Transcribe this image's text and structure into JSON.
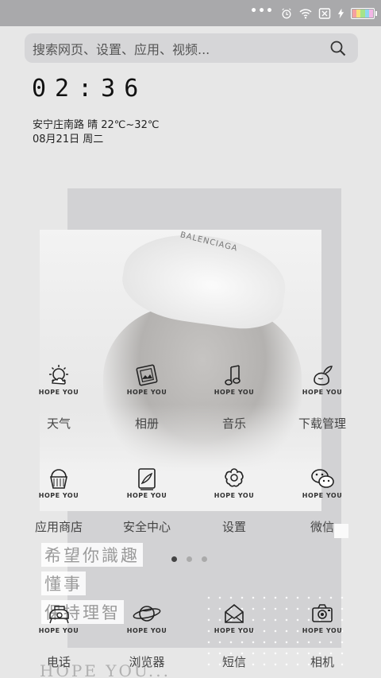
{
  "status_bar": {
    "dots": "•••",
    "icons": [
      "alarm-icon",
      "wifi-icon",
      "sim-off-icon",
      "charging-icon",
      "battery-icon"
    ]
  },
  "search": {
    "placeholder": "搜索网页、设置、应用、视频..."
  },
  "widget": {
    "time": "02:36",
    "weather": "安宁庄南路  晴  22℃~32℃",
    "date": "08月21日 周二"
  },
  "photo_brand": "BALENCIAGA",
  "icon_caption": "HOPE YOU",
  "apps_row1": [
    {
      "icon": "weather-icon",
      "label": "天气"
    },
    {
      "icon": "album-icon",
      "label": "相册"
    },
    {
      "icon": "music-icon",
      "label": "音乐"
    },
    {
      "icon": "download-icon",
      "label": "下载管理"
    }
  ],
  "apps_row2": [
    {
      "icon": "store-icon",
      "label": "应用商店"
    },
    {
      "icon": "security-icon",
      "label": "安全中心"
    },
    {
      "icon": "settings-icon",
      "label": "设置"
    },
    {
      "icon": "wechat-icon",
      "label": "微信"
    }
  ],
  "quote": {
    "line1": "希望你識趣",
    "line2": "懂事",
    "line3": "保持理智",
    "footer": "HOPE YOU..."
  },
  "pager": {
    "pages": 3,
    "active": 0
  },
  "dock": [
    {
      "icon": "phone-icon",
      "label": "电话"
    },
    {
      "icon": "browser-icon",
      "label": "浏览器"
    },
    {
      "icon": "message-icon",
      "label": "短信"
    },
    {
      "icon": "camera-icon",
      "label": "相机"
    }
  ]
}
